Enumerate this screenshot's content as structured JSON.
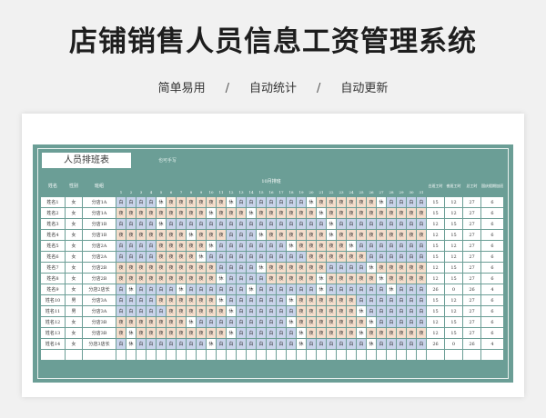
{
  "page": {
    "title": "店铺销售人员信息工资管理系统",
    "features": [
      "简单易用",
      "自动统计",
      "自动更新"
    ],
    "separator": "/"
  },
  "sheet": {
    "tab_label": "人员排班表",
    "note": "也可手写",
    "month_header": "10月排班",
    "headers": {
      "name": "姓名",
      "gender": "性别",
      "shift": "班组",
      "day_hours": "白班工时",
      "night_hours": "夜班工时",
      "total_hours": "总工时",
      "rest": "国庆假期加班"
    },
    "days": [
      "1",
      "2",
      "3",
      "4",
      "5",
      "6",
      "7",
      "8",
      "9",
      "10",
      "11",
      "12",
      "13",
      "14",
      "15",
      "16",
      "17",
      "18",
      "19",
      "20",
      "21",
      "22",
      "23",
      "24",
      "25",
      "26",
      "27",
      "28",
      "29",
      "30",
      "31"
    ],
    "colors": {
      "frame": "#6b9e96",
      "day_cell": "#c9d3ea",
      "night_cell": "#f5ddcb"
    },
    "rows": [
      {
        "name": "姓名1",
        "gender": "女",
        "shift": "分店1A",
        "sched": "白白白白休夜夜夜夜夜夜休白白白白白白白休夜夜夜夜夜夜休白白白白",
        "day_hours": "15",
        "night_hours": "12",
        "total_hours": "27",
        "rest": "6"
      },
      {
        "name": "姓名2",
        "gender": "女",
        "shift": "分店1A",
        "sched": "夜夜夜夜夜夜夜夜夜休夜夜夜休夜夜夜夜夜夜休夜夜夜夜夜夜夜夜夜夜",
        "day_hours": "15",
        "night_hours": "12",
        "total_hours": "27",
        "rest": "6"
      },
      {
        "name": "姓名3",
        "gender": "女",
        "shift": "分店1B",
        "sched": "白白白白休白白白白白白白白白白白白白白白白休白白白白白白白白白",
        "day_hours": "12",
        "night_hours": "15",
        "total_hours": "27",
        "rest": "6"
      },
      {
        "name": "姓名4",
        "gender": "女",
        "shift": "分店1B",
        "sched": "夜夜夜夜夜夜夜休夜夜夜白白白休夜夜夜夜夜夜休夜夜夜夜夜夜夜夜夜",
        "day_hours": "12",
        "night_hours": "15",
        "total_hours": "27",
        "rest": "6"
      },
      {
        "name": "姓名5",
        "gender": "女",
        "shift": "分店2A",
        "sched": "白白白白夜夜夜夜夜休白白白白白白白休夜夜夜夜夜休白白白白白白白",
        "day_hours": "15",
        "night_hours": "12",
        "total_hours": "27",
        "rest": "6"
      },
      {
        "name": "姓名6",
        "gender": "女",
        "shift": "分店2A",
        "sched": "白白白白夜夜夜夜休白白白白白白白白白白夜夜夜夜夜夜白白白白白白",
        "day_hours": "15",
        "night_hours": "12",
        "total_hours": "27",
        "rest": "6"
      },
      {
        "name": "姓名7",
        "gender": "女",
        "shift": "分店2B",
        "sched": "夜夜夜夜夜夜夜夜夜夜白白白白休夜夜夜夜夜夜白白白白休夜夜夜夜夜",
        "day_hours": "12",
        "night_hours": "15",
        "total_hours": "27",
        "rest": "6"
      },
      {
        "name": "姓名8",
        "gender": "女",
        "shift": "分店2B",
        "sched": "夜夜夜夜夜夜夜夜夜夜休白白白白夜夜夜夜夜休夜夜夜夜夜休夜夜夜夜",
        "day_hours": "12",
        "night_hours": "15",
        "total_hours": "27",
        "rest": "6"
      },
      {
        "name": "姓名9",
        "gender": "女",
        "shift": "分店2店长",
        "sched": "白休白白白白休白白白白白白休白白白白白白休白白白白白白休白白白",
        "day_hours": "26",
        "night_hours": "0",
        "total_hours": "26",
        "rest": "4"
      },
      {
        "name": "姓名10",
        "gender": "男",
        "shift": "分店3A",
        "sched": "白白白白夜夜夜夜夜夜休白白白白白白休夜夜夜夜夜夜白白白白白白白",
        "day_hours": "15",
        "night_hours": "12",
        "total_hours": "27",
        "rest": "6"
      },
      {
        "name": "姓名11",
        "gender": "男",
        "shift": "分店3A",
        "sched": "白白白白白夜夜夜夜夜夜休白白白白白白夜夜夜夜夜夜休白白白白白白",
        "day_hours": "15",
        "night_hours": "12",
        "total_hours": "27",
        "rest": "6"
      },
      {
        "name": "姓名12",
        "gender": "女",
        "shift": "分店3B",
        "sched": "夜夜夜夜夜夜夜休白白白白白白白白白休夜夜夜夜夜夜夜休白白白白白",
        "day_hours": "12",
        "night_hours": "15",
        "total_hours": "27",
        "rest": "6"
      },
      {
        "name": "姓名13",
        "gender": "女",
        "shift": "分店3B",
        "sched": "夜休夜夜夜夜夜夜夜夜夜休白白白白白白休夜夜夜夜夜休夜夜夜夜夜夜",
        "day_hours": "12",
        "night_hours": "15",
        "total_hours": "27",
        "rest": "6"
      },
      {
        "name": "姓名14",
        "gender": "女",
        "shift": "分店3店长",
        "sched": "白休白白白白白白白休白白白白白白白白休白白白白白白休白白白白白",
        "day_hours": "26",
        "night_hours": "0",
        "total_hours": "26",
        "rest": "4"
      }
    ]
  }
}
